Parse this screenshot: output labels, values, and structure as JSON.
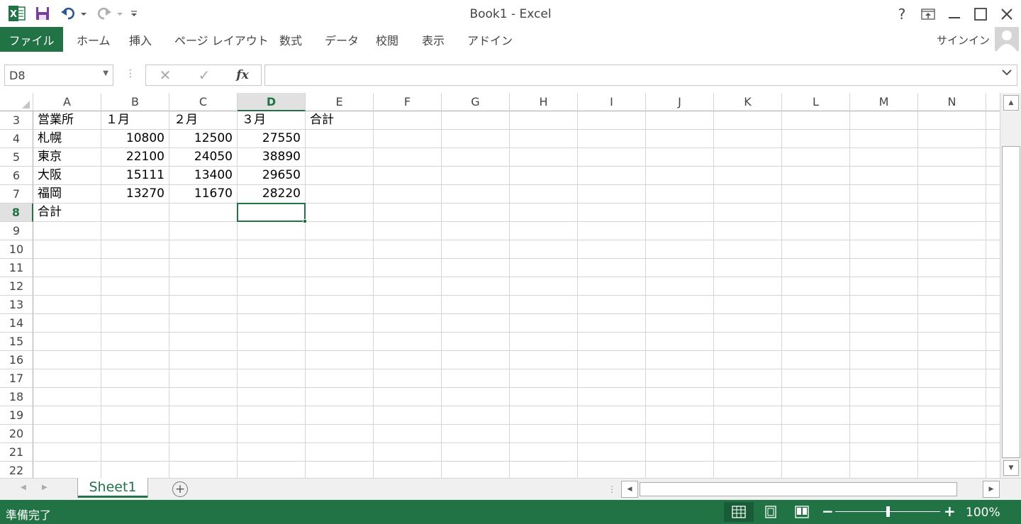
{
  "window": {
    "title": "Book1 - Excel",
    "help": "?",
    "minimize": "—",
    "maximize": "☐",
    "close": "✕"
  },
  "ribbon": {
    "file_tab": "ファイル",
    "tabs": [
      "ホーム",
      "挿入",
      "ページ レイアウト",
      "数式",
      "データ",
      "校閲",
      "表示",
      "アドイン"
    ],
    "signin": "サインイン"
  },
  "formula_bar": {
    "name_box": "D8",
    "cancel_glyph": "✕",
    "enter_glyph": "✓",
    "fx_label": "fx",
    "formula": ""
  },
  "grid": {
    "columns": [
      "A",
      "B",
      "C",
      "D",
      "E",
      "F",
      "G",
      "H",
      "I",
      "J",
      "K",
      "L",
      "M",
      "N"
    ],
    "selected_column": "D",
    "rows": [
      {
        "num": "3",
        "cells": [
          "営業所",
          "１月",
          "２月",
          "３月",
          "合計"
        ]
      },
      {
        "num": "4",
        "cells": [
          "札幌",
          "10800",
          "12500",
          "27550",
          ""
        ]
      },
      {
        "num": "5",
        "cells": [
          "東京",
          "22100",
          "24050",
          "38890",
          ""
        ]
      },
      {
        "num": "6",
        "cells": [
          "大阪",
          "15111",
          "13400",
          "29650",
          ""
        ]
      },
      {
        "num": "7",
        "cells": [
          "福岡",
          "13270",
          "11670",
          "28220",
          ""
        ]
      },
      {
        "num": "8",
        "cells": [
          "合計",
          "",
          "",
          "",
          ""
        ]
      },
      {
        "num": "9",
        "cells": []
      },
      {
        "num": "10",
        "cells": []
      },
      {
        "num": "11",
        "cells": []
      },
      {
        "num": "12",
        "cells": []
      },
      {
        "num": "13",
        "cells": []
      },
      {
        "num": "14",
        "cells": []
      },
      {
        "num": "15",
        "cells": []
      },
      {
        "num": "16",
        "cells": []
      },
      {
        "num": "17",
        "cells": []
      },
      {
        "num": "18",
        "cells": []
      },
      {
        "num": "19",
        "cells": []
      },
      {
        "num": "20",
        "cells": []
      },
      {
        "num": "21",
        "cells": []
      },
      {
        "num": "22",
        "cells": []
      }
    ],
    "selected_row": "8"
  },
  "sheets": {
    "tabs": [
      "Sheet1"
    ],
    "add_glyph": "+"
  },
  "status": {
    "text": "準備完了",
    "zoom_minus": "−",
    "zoom_plus": "+",
    "zoom": "100%",
    "zoom_fraction": 0.5
  },
  "colors": {
    "accent": "#217346"
  }
}
